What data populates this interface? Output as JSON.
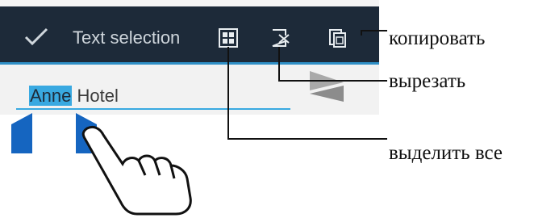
{
  "actionbar": {
    "title": "Text selection",
    "done_icon": "checkmark-icon",
    "select_all_icon": "select-all-icon",
    "cut_icon": "cut-icon",
    "copy_icon": "copy-icon"
  },
  "field": {
    "selected_text": "Anne",
    "rest_text": " Hotel"
  },
  "callouts": {
    "copy": "копировать",
    "cut": "вырезать",
    "select_all": "выделить все"
  },
  "colors": {
    "actionbar_bg": "#1d2a39",
    "accent": "#39a9e1",
    "handle": "#1565c0"
  }
}
